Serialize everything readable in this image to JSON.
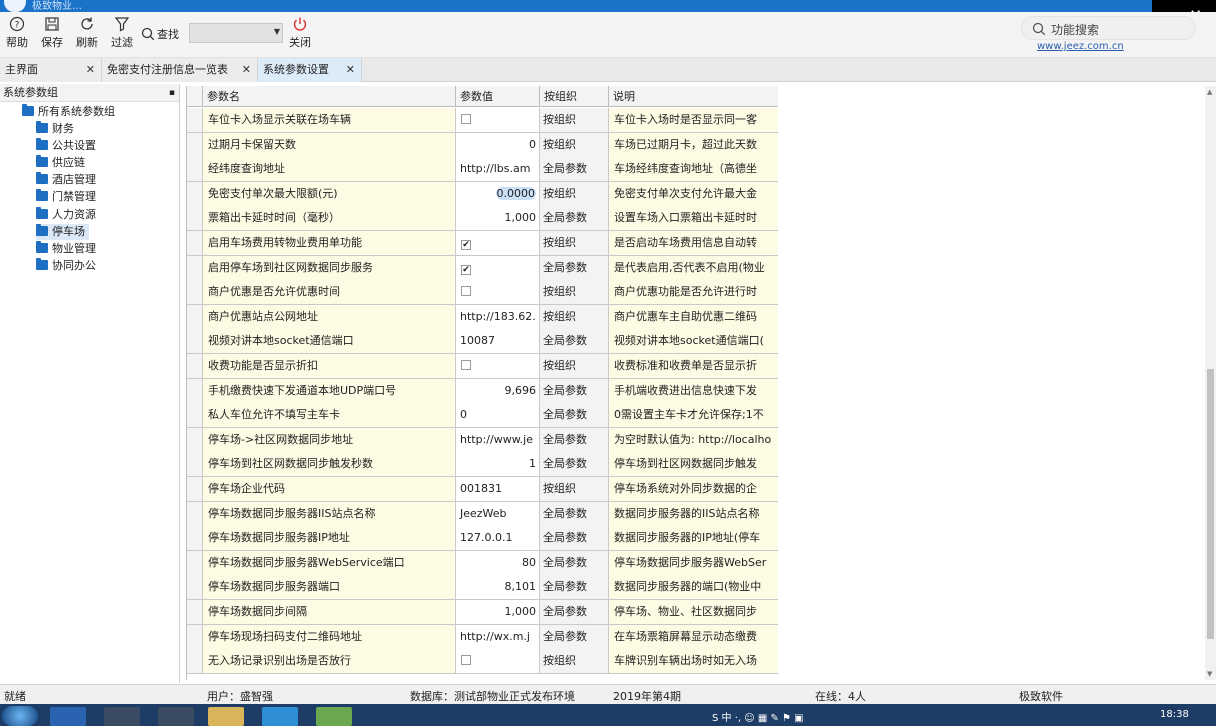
{
  "window": {
    "title_text": "极致物业…",
    "close_glyph": "✕"
  },
  "toolbar": {
    "buttons": [
      {
        "label": "帮助",
        "icon": "help-icon"
      },
      {
        "label": "保存",
        "icon": "save-icon"
      },
      {
        "label": "刷新",
        "icon": "refresh-icon"
      },
      {
        "label": "过滤",
        "icon": "filter-icon"
      }
    ],
    "search_label": "查找",
    "search_value": "",
    "close_label": "关闭",
    "feature_search": "功能搜索",
    "website": "www.jeez.com.cn"
  },
  "tabs": [
    {
      "label": "主界面",
      "active": false
    },
    {
      "label": "免密支付注册信息一览表",
      "active": false
    },
    {
      "label": "系统参数设置",
      "active": true
    }
  ],
  "tab_close": "✕",
  "tree": {
    "header": "系统参数组",
    "pin": "▪",
    "root": "所有系统参数组",
    "items": [
      "财务",
      "公共设置",
      "供应链",
      "酒店管理",
      "门禁管理",
      "人力资源",
      "停车场",
      "物业管理",
      "协同办公"
    ],
    "selected_index": 6
  },
  "grid": {
    "columns": [
      "参数名",
      "参数值",
      "按组织",
      "说明"
    ],
    "rows": [
      {
        "name": "车位卡入场显示关联在场车辆",
        "value": "",
        "type": "checkbox",
        "checked": false,
        "org": "按组织",
        "desc": "车位卡入场时是否显示同一客"
      },
      {
        "name": "过期月卡保留天数",
        "value": "0",
        "type": "num",
        "org": "按组织",
        "desc": "车场已过期月卡，超过此天数"
      },
      {
        "name": "经纬度查询地址",
        "value": "http://lbs.am",
        "type": "text",
        "org": "全局参数",
        "desc": "车场经纬度查询地址（高德坐"
      },
      {
        "name": "免密支付单次最大限额(元)",
        "value": "0.0000",
        "type": "num",
        "highlight": true,
        "org": "按组织",
        "desc": "免密支付单次支付允许最大金"
      },
      {
        "name": "票箱出卡延时时间（毫秒）",
        "value": "1,000",
        "type": "num",
        "org": "全局参数",
        "desc": "设置车场入口票箱出卡延时时"
      },
      {
        "name": "启用车场费用转物业费用单功能",
        "value": "",
        "type": "checkbox",
        "checked": true,
        "org": "按组织",
        "desc": "是否启动车场费用信息自动转"
      },
      {
        "name": "启用停车场到社区网数据同步服务",
        "value": "",
        "type": "checkbox",
        "checked": true,
        "org": "全局参数",
        "desc": "是代表启用,否代表不启用(物业"
      },
      {
        "name": "商户优惠是否允许优惠时间",
        "value": "",
        "type": "checkbox",
        "checked": false,
        "org": "按组织",
        "desc": "商户优惠功能是否允许进行时"
      },
      {
        "name": "商户优惠站点公网地址",
        "value": "http://183.62.",
        "type": "text",
        "org": "按组织",
        "desc": "商户优惠车主自助优惠二维码"
      },
      {
        "name": "视频对讲本地socket通信端口",
        "value": "10087",
        "type": "text",
        "org": "全局参数",
        "desc": "视频对讲本地socket通信端口("
      },
      {
        "name": "收费功能是否显示折扣",
        "value": "",
        "type": "checkbox",
        "checked": false,
        "org": "按组织",
        "desc": "收费标准和收费单是否显示折"
      },
      {
        "name": "手机缴费快速下发通道本地UDP端口号",
        "value": "9,696",
        "type": "num",
        "org": "全局参数",
        "desc": "手机端收费进出信息快速下发"
      },
      {
        "name": "私人车位允许不填写主车卡",
        "value": "0",
        "type": "text",
        "org": "全局参数",
        "desc": "0需设置主车卡才允许保存;1不"
      },
      {
        "name": "停车场->社区网数据同步地址",
        "value": "http://www.je",
        "type": "text",
        "org": "全局参数",
        "desc": "为空时默认值为: http://localho"
      },
      {
        "name": "停车场到社区网数据同步触发秒数",
        "value": "1",
        "type": "num",
        "org": "全局参数",
        "desc": "停车场到社区网数据同步触发"
      },
      {
        "name": "停车场企业代码",
        "value": "001831",
        "type": "text",
        "org": "按组织",
        "desc": "停车场系统对外同步数据的企"
      },
      {
        "name": "停车场数据同步服务器IIS站点名称",
        "value": "JeezWeb",
        "type": "text",
        "org": "全局参数",
        "desc": "数据同步服务器的IIS站点名称"
      },
      {
        "name": "停车场数据同步服务器IP地址",
        "value": "127.0.0.1",
        "type": "text",
        "org": "全局参数",
        "desc": "数据同步服务器的IP地址(停车"
      },
      {
        "name": "停车场数据同步服务器WebService端口",
        "value": "80",
        "type": "num",
        "org": "全局参数",
        "desc": "停车场数据同步服务器WebSer"
      },
      {
        "name": "停车场数据同步服务器端口",
        "value": "8,101",
        "type": "num",
        "org": "全局参数",
        "desc": "数据同步服务器的端口(物业中"
      },
      {
        "name": "停车场数据同步间隔",
        "value": "1,000",
        "type": "num",
        "org": "全局参数",
        "desc": "停车场、物业、社区数据同步"
      },
      {
        "name": "停车场现场扫码支付二维码地址",
        "value": "http://wx.m.j",
        "type": "text",
        "org": "全局参数",
        "desc": "在车场票箱屏幕显示动态缴费"
      },
      {
        "name": "无入场记录识别出场是否放行",
        "value": "",
        "type": "checkbox",
        "checked": false,
        "org": "按组织",
        "desc": "车牌识别车辆出场时如无入场"
      }
    ]
  },
  "status": {
    "ready": "就绪",
    "user": "用户：盛智强",
    "database": "数据库：测试部物业正式发布环境",
    "period": "2019年第4期",
    "online": "在线：4人",
    "company": "极致软件"
  },
  "taskbar": {
    "tray": "S 中 ·, ☺ ▦ ✎ ⚑ ▣",
    "clock": "18:38"
  },
  "colors": {
    "title_blue": "#1a73c8",
    "name_cell_bg": "#fdfbe3",
    "close_red": "#e0302f",
    "taskbar": "#1d3c66"
  }
}
